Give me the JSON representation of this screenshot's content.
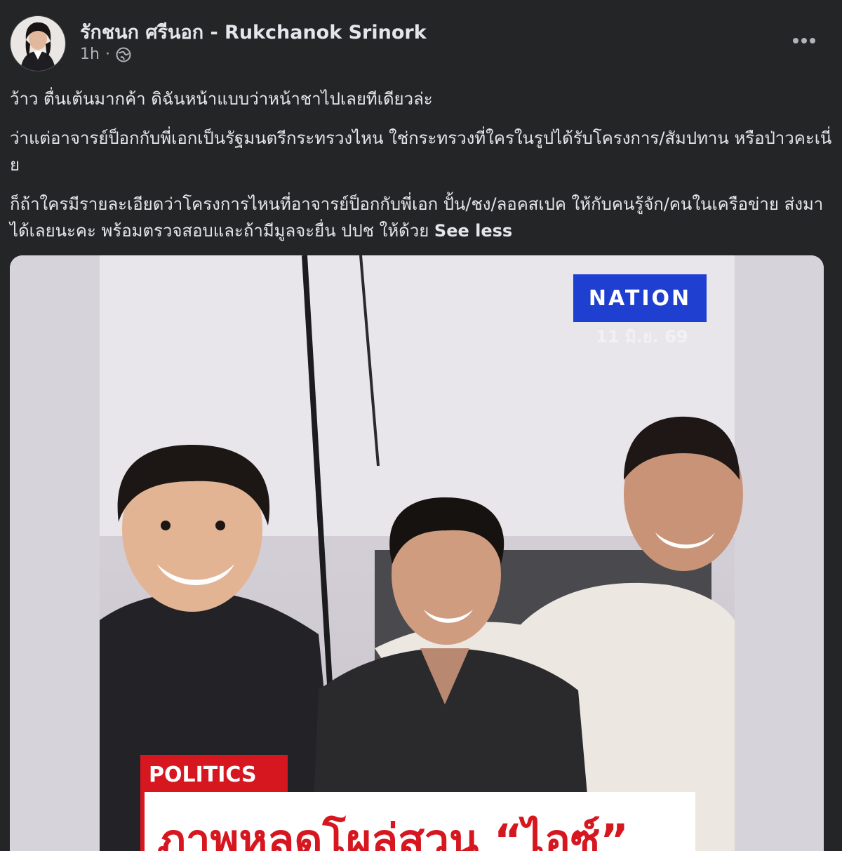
{
  "post": {
    "author": "รักชนก ศรีนอก - Rukchanok Srinork",
    "time": "1h",
    "separator": "·",
    "privacy_icon": "globe-icon",
    "more_icon": "more-options-icon",
    "paragraphs": [
      "ว้าว ตื่นเต้นมากค้า ดิฉันหน้าแบบว่าหน้าชาไปเลยทีเดียวล่ะ",
      "ว่าแต่อาจารย์ป็อกกับพี่เอกเป็นรัฐมนตรีกระทรวงไหน ใช่กระทรวงที่ใครในรูปได้รับโครงการ/สัมปทาน หรือป่าวคะเนี่ย",
      "ก็ถ้าใครมีรายละเอียดว่าโครงการไหนที่อาจารย์ป็อกกับพี่เอก ปั้น/ชง/ลอคสเปค ให้กับคนรู้จัก/คนในเครือข่าย ส่งมาได้เลยนะคะ  พร้อมตรวจสอบและถ้ามีมูลจะยื่น ปปช ให้ด้วย"
    ],
    "see_less": "See less"
  },
  "media": {
    "badge": "NATION",
    "date": "11 มิ.ย. 69",
    "tag": "POLITICS",
    "headline": "ภาพหลุดโผล่สวน “ไอซ์”"
  },
  "colors": {
    "background": "#242526",
    "text": "#e4e6eb",
    "secondary_text": "#b0b3b8",
    "nation_blue": "#1f3fd1",
    "politics_red": "#d6171f"
  }
}
